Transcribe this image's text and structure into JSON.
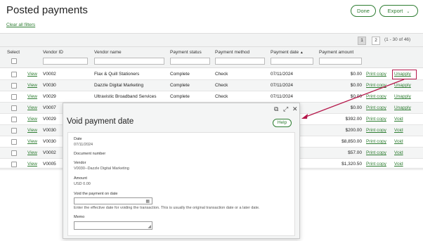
{
  "header": {
    "title": "Posted payments",
    "done_label": "Done",
    "export_label": "Export",
    "export_chevron": "⌄",
    "clear_filters": "Clear all filters"
  },
  "pager": {
    "pages": [
      "1",
      "2"
    ],
    "current_page": "1",
    "range_text": "(1 - 30 of 46)"
  },
  "table": {
    "columns": {
      "select": "Select",
      "vendor_id": "Vendor ID",
      "vendor_name": "Vendor name",
      "payment_status": "Payment status",
      "payment_method": "Payment method",
      "payment_date": "Payment date",
      "payment_date_sort": "▲",
      "payment_amount": "Payment amount"
    },
    "rows": [
      {
        "view": "View",
        "vendor_id": "V0002",
        "vendor_name": "Flax & Quill Stationers",
        "status": "Complete",
        "method": "Check",
        "date": "07/11/2024",
        "amount": "$0.00",
        "action1": "Print copy",
        "action2": "Unapply"
      },
      {
        "view": "View",
        "vendor_id": "V0030",
        "vendor_name": "Dazzle Digital Marketing",
        "status": "Complete",
        "method": "Check",
        "date": "07/11/2024",
        "amount": "$0.00",
        "action1": "Print copy",
        "action2": "Unapply"
      },
      {
        "view": "View",
        "vendor_id": "V0029",
        "vendor_name": "Ultravistic Broadband Services",
        "status": "Complete",
        "method": "Check",
        "date": "07/11/2024",
        "amount": "$0.00",
        "action1": "Print copy",
        "action2": "Unapply"
      },
      {
        "view": "View",
        "vendor_id": "V0007",
        "vendor_name": "",
        "status": "",
        "method": "",
        "date": "",
        "amount": "$0.00",
        "action1": "Print copy",
        "action2": "Unapply"
      },
      {
        "view": "View",
        "vendor_id": "V0029",
        "vendor_name": "",
        "status": "",
        "method": "",
        "date": "",
        "amount": "$392.00",
        "action1": "Print copy",
        "action2": "Void"
      },
      {
        "view": "View",
        "vendor_id": "V0030",
        "vendor_name": "",
        "status": "",
        "method": "",
        "date": "",
        "amount": "$200.00",
        "action1": "Print copy",
        "action2": "Void"
      },
      {
        "view": "View",
        "vendor_id": "V0030",
        "vendor_name": "",
        "status": "",
        "method": "",
        "date": "",
        "amount": "$8,850.00",
        "action1": "Print copy",
        "action2": "Void"
      },
      {
        "view": "View",
        "vendor_id": "V0002",
        "vendor_name": "",
        "status": "",
        "method": "",
        "date": "",
        "amount": "$57.00",
        "action1": "Print copy",
        "action2": "Void"
      },
      {
        "view": "View",
        "vendor_id": "V0005",
        "vendor_name": "",
        "status": "",
        "method": "",
        "date": "",
        "amount": "$1,320.50",
        "action1": "Print copy",
        "action2": "Void"
      }
    ]
  },
  "modal": {
    "title": "Void payment date",
    "help_label": "Help",
    "tools": {
      "popout": "⧉",
      "expand": "⤢",
      "close": "✕"
    },
    "date_label": "Date",
    "date_value": "07/11/2024",
    "document_label": "Document number",
    "vendor_label": "Vendor",
    "vendor_value": "V0030--Dazzle Digital Marketing",
    "amount_label": "Amount",
    "amount_value": "USD 0.00",
    "void_label": "Void the payment on date",
    "void_help": "Enter the effective date for voiding the transaction. This is usually the original transaction date or a later date.",
    "memo_label": "Memo",
    "calendar_icon": "▦",
    "resize_grip": "◢"
  },
  "colors": {
    "accent": "#2e7d32",
    "highlight": "#b5174a"
  }
}
